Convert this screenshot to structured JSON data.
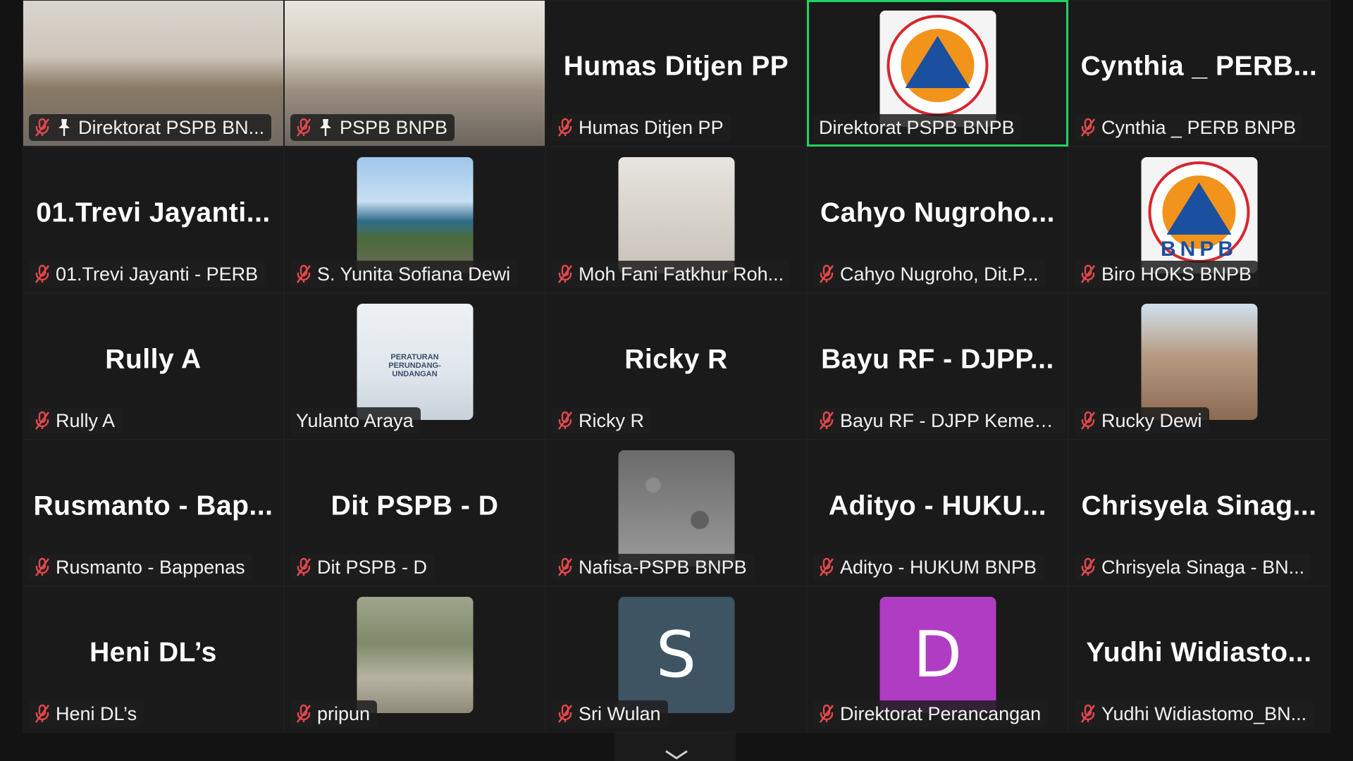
{
  "colors": {
    "active_speaker_border": "#23d160",
    "mic_muted": "#e5484d",
    "tile_bg": "#1a1a1a"
  },
  "tiles": [
    {
      "type": "video-room1",
      "label": "Direktorat PSPB BN...",
      "pinned": true
    },
    {
      "type": "video-room2",
      "label": "PSPB BNPB",
      "pinned": true
    },
    {
      "type": "name",
      "big_name": "Humas Ditjen PP",
      "label": "Humas Ditjen PP"
    },
    {
      "type": "logo",
      "label": "Direktorat PSPB BNPB",
      "active": true,
      "no_mic": true
    },
    {
      "type": "name",
      "big_name": "Cynthia _ PERB...",
      "label": "Cynthia _ PERB BNPB"
    },
    {
      "type": "name",
      "big_name": "01.Trevi  Jayanti...",
      "label": "01.Trevi Jayanti - PERB"
    },
    {
      "type": "photo-beach",
      "label": "S. Yunita Sofiana Dewi"
    },
    {
      "type": "photo-redman",
      "label": "Moh Fani Fatkhur Roh..."
    },
    {
      "type": "name",
      "big_name": "Cahyo  Nugroho...",
      "label": "Cahyo Nugroho, Dit.P..."
    },
    {
      "type": "logo-bnpb",
      "label": "Biro HOKS BNPB",
      "logo_text": "BNPB"
    },
    {
      "type": "name",
      "big_name": "Rully A",
      "label": "Rully A"
    },
    {
      "type": "photo-doc",
      "label": "Yulanto Araya",
      "no_mic": true,
      "doc_text": "PERATURAN PERUNDANG-UNDANGAN"
    },
    {
      "type": "name",
      "big_name": "Ricky R",
      "label": "Ricky R"
    },
    {
      "type": "name",
      "big_name": "Bayu RF - DJPP...",
      "label": "Bayu RF - DJPP Kemen..."
    },
    {
      "type": "photo-woman",
      "label": "Rucky Dewi"
    },
    {
      "type": "name",
      "big_name": "Rusmanto  -  Bap...",
      "label": "Rusmanto - Bappenas"
    },
    {
      "type": "name",
      "big_name": "Dit PSPB - D",
      "label": "Dit PSPB - D"
    },
    {
      "type": "photo-rocks",
      "label": "Nafisa-PSPB BNPB"
    },
    {
      "type": "name",
      "big_name": "Adityo  -  HUKU...",
      "label": "Adityo - HUKUM BNPB"
    },
    {
      "type": "name",
      "big_name": "Chrisyela  Sinag...",
      "label": "Chrisyela Sinaga - BN..."
    },
    {
      "type": "name",
      "big_name": "Heni DL’s",
      "label": "Heni DL’s"
    },
    {
      "type": "photo-field",
      "label": "pripun"
    },
    {
      "type": "letter",
      "letter": "S",
      "color": "#3f5463",
      "label": "Sri Wulan"
    },
    {
      "type": "letter",
      "letter": "D",
      "color": "#b13cc4",
      "label": "Direktorat Perancangan"
    },
    {
      "type": "name",
      "big_name": "Yudhi  Widiasto...",
      "label": "Yudhi Widiastomo_BN..."
    }
  ],
  "controls": {
    "scroll_down_icon": "chevron-down-icon"
  }
}
